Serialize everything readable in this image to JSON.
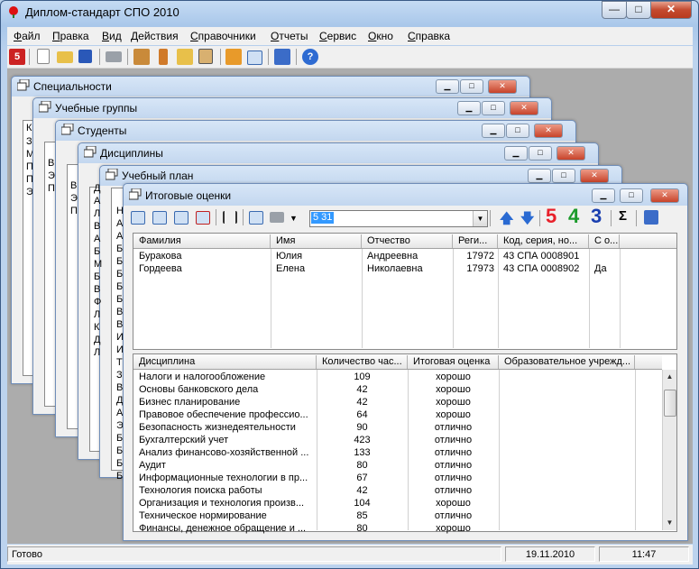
{
  "app": {
    "title": "Диплом-стандарт СПО 2010",
    "min": "—",
    "max": "□",
    "close": "✕"
  },
  "menu": [
    "Файл",
    "Правка",
    "Вид",
    "Действия",
    "Справочники",
    "Отчеты",
    "Сервис",
    "Окно",
    "Справка"
  ],
  "toolbar_icons": [
    "grade-5-icon",
    "new-document-icon",
    "open-folder-icon",
    "save-icon",
    "print-icon",
    "home-icon",
    "tools-icon",
    "folders-icon",
    "id-card-icon",
    "book-icon",
    "table-icon",
    "help-book-icon",
    "help-icon"
  ],
  "windows": {
    "specialties": {
      "title": "Специальности",
      "stub": [
        "К",
        "З",
        "М",
        "П",
        "П",
        "Э"
      ]
    },
    "groups": {
      "title": "Учебные группы",
      "stub": [
        "В",
        "Э",
        "П"
      ]
    },
    "students": {
      "title": "Студенты",
      "stub": [
        "В",
        "Э",
        "П"
      ]
    },
    "disciplines": {
      "title": "Дисциплины",
      "stub": [
        "Д",
        "А",
        "Л",
        "В",
        "А",
        "Б",
        "М",
        "Б",
        "В",
        "Ф",
        "Л",
        "К",
        "Д",
        "Л"
      ]
    },
    "plan": {
      "title": "Учебный план",
      "stub": [
        "Н",
        "А",
        "А",
        "Б",
        "Б",
        "Б",
        "Б",
        "Б",
        "В",
        "В",
        "И",
        "И",
        "Т",
        "З",
        "В",
        "Д",
        "А",
        "Э",
        "Б",
        "Б",
        "Б",
        "Б"
      ]
    }
  },
  "grades": {
    "title": "Итоговые оценки",
    "combo_value": "5 31",
    "grade_labels": [
      "5",
      "4",
      "3"
    ],
    "sigma": "Σ",
    "students_columns": [
      "Фамилия",
      "Имя",
      "Отчество",
      "Реги...",
      "Код, серия, но...",
      "С о..."
    ],
    "students": [
      {
        "last": "Буракова",
        "first": "Юлия",
        "patronymic": "Андреевна",
        "reg": "17972",
        "code": "43 СПА 0008901",
        "honors": ""
      },
      {
        "last": "Гордеева",
        "first": "Елена",
        "patronymic": "Николаевна",
        "reg": "17973",
        "code": "43 СПА 0008902",
        "honors": "Да"
      }
    ],
    "disc_columns": [
      "Дисциплина",
      "Количество час...",
      "Итоговая оценка",
      "Образовательное учрежд..."
    ],
    "disciplines": [
      {
        "name": "Налоги и налогообложение",
        "hours": "109",
        "grade": "хорошо"
      },
      {
        "name": "Основы банковского дела",
        "hours": "42",
        "grade": "хорошо"
      },
      {
        "name": "Бизнес планирование",
        "hours": "42",
        "grade": "хорошо"
      },
      {
        "name": "Правовое обеспечение профессио...",
        "hours": "64",
        "grade": "хорошо"
      },
      {
        "name": "Безопасность жизнедеятельности",
        "hours": "90",
        "grade": "отлично"
      },
      {
        "name": "Бухгалтерский учет",
        "hours": "423",
        "grade": "отлично"
      },
      {
        "name": "Анализ финансово-хозяйственной ...",
        "hours": "133",
        "grade": "отлично"
      },
      {
        "name": "Аудит",
        "hours": "80",
        "grade": "отлично"
      },
      {
        "name": "Информационные технологии в пр...",
        "hours": "67",
        "grade": "отлично"
      },
      {
        "name": "Технология поиска работы",
        "hours": "42",
        "grade": "отлично"
      },
      {
        "name": "Организация и технология произв...",
        "hours": "104",
        "grade": "хорошо"
      },
      {
        "name": "Техническое нормирование",
        "hours": "85",
        "grade": "отлично"
      },
      {
        "name": "Финансы, денежное обращение и ...",
        "hours": "80",
        "grade": "хорошо"
      }
    ]
  },
  "status": {
    "text": "Готово",
    "date": "19.11.2010",
    "time": "11:47"
  },
  "colors": {
    "grade5": "#e8202a",
    "grade4": "#1a9a2a",
    "grade3": "#1a3fb0",
    "selection": "#3399ff"
  }
}
